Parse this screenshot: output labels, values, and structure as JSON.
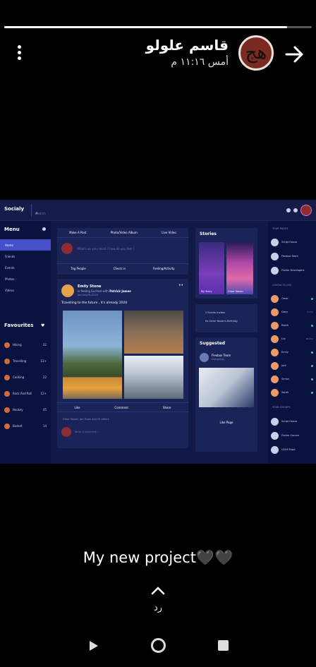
{
  "story": {
    "progress": 0.92,
    "user_name": "قاسم علولو",
    "time": "أمس ١١:١٦ م",
    "avatar_glyph": "ﻫﺞ",
    "caption": "My new project🖤🖤",
    "reply_label": "رد"
  },
  "shot": {
    "brand": "Socialy",
    "search_placeholder": "Search",
    "menu_title": "Menu",
    "menu": [
      "Home",
      "Friends",
      "Events",
      "Photos",
      "Videos"
    ],
    "fav_title": "Favourites",
    "favourites": [
      {
        "name": "Hiking",
        "count": "22"
      },
      {
        "name": "Travelling",
        "count": "12+"
      },
      {
        "name": "Cooking",
        "count": "22"
      },
      {
        "name": "Rock And Roll",
        "count": "12+"
      },
      {
        "name": "Hockey",
        "count": "45"
      },
      {
        "name": "Basket",
        "count": "14"
      }
    ],
    "create": {
      "tabs": [
        "Make A Post",
        "Photo/Video Album",
        "Live Video"
      ],
      "placeholder": "What's on your mind ? how do you feel ?",
      "actions": [
        "Tag People",
        "Check in",
        "Feeling/Activity"
      ]
    },
    "post": {
      "author": "Emily Stone",
      "meta_prefix": "is feeling Excited",
      "meta_with": "with",
      "meta_friend": "Patrick James",
      "date": "January/01/2020",
      "dots": "••",
      "text": "Travelling to the future , it's already 2020",
      "actions": [
        "Like",
        "Comment",
        "Share"
      ],
      "likes": "Omar Yasser, Jon Snow and 15 others",
      "comment_placeholder": "Write a comment..."
    },
    "stories": {
      "title": "Stories",
      "items": [
        "My Story",
        "Omar Yasser"
      ]
    },
    "events": [
      "2 Events Invites",
      "Its Omar Yasser's Birthday"
    ],
    "suggested": {
      "title": "Suggested",
      "name": "Flexbox Team",
      "sub": "Designing",
      "like_label": "Like Page"
    },
    "right": {
      "pages_title": "YOUR PAGES",
      "pages": [
        "Script House",
        "Flexbox Team",
        "Flutter Developers"
      ],
      "contacts_title": "CONTACTS (26)",
      "contacts": [
        {
          "name": "Omar",
          "time": ""
        },
        {
          "name": "Dany",
          "time": "5 min"
        },
        {
          "name": "Rabih",
          "time": ""
        },
        {
          "name": "Lily",
          "time": "26 min"
        },
        {
          "name": "Emily",
          "time": ""
        },
        {
          "name": "Jack",
          "time": ""
        },
        {
          "name": "Simon",
          "time": ""
        },
        {
          "name": "Sarah",
          "time": ""
        }
      ],
      "groups_title": "YOUR GROUPS",
      "groups": [
        "Script House",
        "Flutter Course",
        "UI/UX Expe"
      ]
    }
  }
}
